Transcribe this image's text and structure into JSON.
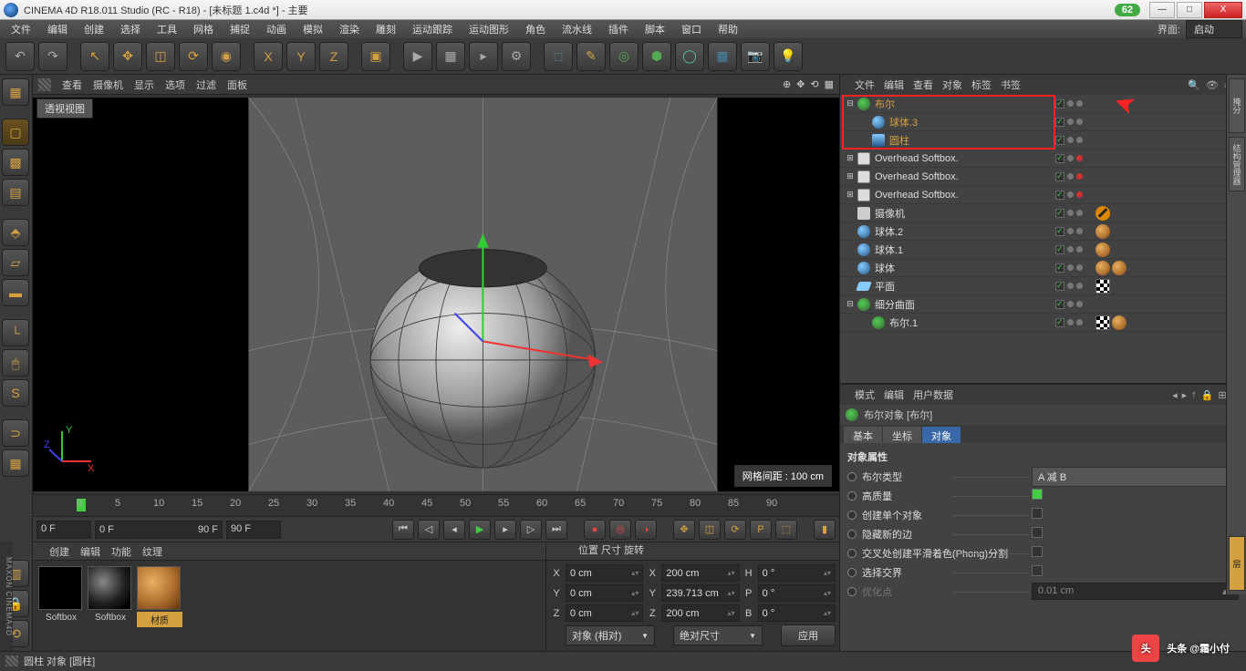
{
  "window": {
    "title": "CINEMA 4D R18.011 Studio (RC - R18) - [未标题 1.c4d *] - 主要",
    "badge": "62"
  },
  "winbtns": {
    "min": "—",
    "max": "□",
    "close": "X"
  },
  "menu": [
    "文件",
    "编辑",
    "创建",
    "选择",
    "工具",
    "网格",
    "捕捉",
    "动画",
    "模拟",
    "渲染",
    "雕刻",
    "运动跟踪",
    "运动图形",
    "角色",
    "流水线",
    "插件",
    "脚本",
    "窗口",
    "帮助"
  ],
  "menuRight": {
    "label": "界面:",
    "value": "启动"
  },
  "viewportMenu": [
    "查看",
    "摄像机",
    "显示",
    "选项",
    "过滤",
    "面板"
  ],
  "viewport": {
    "label": "透视视图",
    "gridInfo": "网格间距 : 100 cm",
    "axes": {
      "x": "X",
      "y": "Y",
      "z": "Z"
    }
  },
  "timeline": {
    "ticks": [
      "0",
      "5",
      "10",
      "15",
      "20",
      "25",
      "30",
      "35",
      "40",
      "45",
      "50",
      "55",
      "60",
      "65",
      "70",
      "75",
      "80",
      "85",
      "90"
    ]
  },
  "playbar": {
    "cur": "0 F",
    "rangeStart": "0 F",
    "rangeEnd": "90 F",
    "end": "90 F"
  },
  "materials": {
    "menu": [
      "创建",
      "编辑",
      "功能",
      "纹理"
    ],
    "items": [
      {
        "type": "black",
        "label": "Softbox"
      },
      {
        "type": "ball",
        "label": "Softbox"
      },
      {
        "type": "wood",
        "label": "材质",
        "sel": true
      }
    ]
  },
  "coords": {
    "heads": [
      "位置",
      "尺寸",
      "旋转"
    ],
    "rows": [
      {
        "axis": "X",
        "pos": "0 cm",
        "size": "200 cm",
        "rlabel": "H",
        "rot": "0 °"
      },
      {
        "axis": "Y",
        "pos": "0 cm",
        "size": "239.713 cm",
        "rlabel": "P",
        "rot": "0 °"
      },
      {
        "axis": "Z",
        "pos": "0 cm",
        "size": "200 cm",
        "rlabel": "B",
        "rot": "0 °"
      }
    ],
    "sel1": "对象 (相对)",
    "sel2": "绝对尺寸",
    "apply": "应用"
  },
  "objMenu": [
    "文件",
    "编辑",
    "查看",
    "对象",
    "标签",
    "书签"
  ],
  "objects": [
    {
      "depth": 0,
      "exp": "⊟",
      "icon": "bool",
      "label": "布尔",
      "sel": true,
      "chk": true,
      "dots": [
        "gy",
        "gy"
      ]
    },
    {
      "depth": 1,
      "exp": "",
      "icon": "sphere",
      "label": "球体.3",
      "sel": true,
      "chk": true,
      "dots": [
        "gy",
        "gy"
      ],
      "tags": [
        "dots"
      ]
    },
    {
      "depth": 1,
      "exp": "",
      "icon": "cyl",
      "label": "圆柱",
      "sel": true,
      "chk": true,
      "dots": [
        "gy",
        "gy"
      ],
      "tags": [
        "dots"
      ]
    },
    {
      "depth": 0,
      "exp": "⊞",
      "icon": "light",
      "label": "Overhead Softbox.",
      "chk": true,
      "dots": [
        "gy",
        "rd"
      ],
      "tags": [
        "dots"
      ]
    },
    {
      "depth": 0,
      "exp": "⊞",
      "icon": "light",
      "label": "Overhead Softbox.",
      "chk": true,
      "dots": [
        "gy",
        "rd"
      ],
      "tags": [
        "dots"
      ]
    },
    {
      "depth": 0,
      "exp": "⊞",
      "icon": "light",
      "label": "Overhead Softbox.",
      "chk": true,
      "dots": [
        "gy",
        "rd"
      ],
      "tags": [
        "dots"
      ]
    },
    {
      "depth": 0,
      "exp": "",
      "icon": "cam",
      "label": "摄像机",
      "chk": true,
      "dots": [
        "gy",
        "gy"
      ],
      "tags": [
        "no"
      ]
    },
    {
      "depth": 0,
      "exp": "",
      "icon": "sphere",
      "label": "球体.2",
      "chk": true,
      "dots": [
        "gy",
        "gy"
      ],
      "tags": [
        "dots",
        "mat"
      ]
    },
    {
      "depth": 0,
      "exp": "",
      "icon": "sphere",
      "label": "球体.1",
      "chk": true,
      "dots": [
        "gy",
        "gy"
      ],
      "tags": [
        "dots",
        "mat"
      ]
    },
    {
      "depth": 0,
      "exp": "",
      "icon": "sphere",
      "label": "球体",
      "chk": true,
      "dots": [
        "gy",
        "gy"
      ],
      "tags": [
        "dots",
        "mat",
        "mat"
      ]
    },
    {
      "depth": 0,
      "exp": "",
      "icon": "plane",
      "label": "平面",
      "chk": true,
      "dots": [
        "gy",
        "gy"
      ],
      "tags": [
        "dots",
        "chk"
      ]
    },
    {
      "depth": 0,
      "exp": "⊟",
      "icon": "subdiv",
      "label": "细分曲面",
      "chk": true,
      "dots": [
        "gy",
        "gy"
      ]
    },
    {
      "depth": 1,
      "exp": "",
      "icon": "bool",
      "label": "布尔.1",
      "chk": true,
      "dots": [
        "gy",
        "gy"
      ],
      "tags": [
        "chk",
        "mat"
      ]
    }
  ],
  "attrMenu": [
    "模式",
    "编辑",
    "用户数据"
  ],
  "attrTitle": "布尔对象 [布尔]",
  "attrTabs": [
    {
      "l": "基本"
    },
    {
      "l": "坐标"
    },
    {
      "l": "对象",
      "a": true
    }
  ],
  "attrSection": "对象属性",
  "attrs": [
    {
      "label": "布尔类型",
      "type": "sel",
      "value": "A 减 B"
    },
    {
      "label": "高质量",
      "type": "chk",
      "on": true
    },
    {
      "label": "创建单个对象",
      "type": "chk"
    },
    {
      "label": "隐藏新的边",
      "type": "chk"
    },
    {
      "label": "交叉处创建平滑着色(Phong)分割",
      "type": "chk"
    },
    {
      "label": "选择交界",
      "type": "chk"
    },
    {
      "label": "优化点",
      "type": "input",
      "value": "0.01 cm",
      "dim": true
    }
  ],
  "status": "圆柱 对象 [圆柱]",
  "watermark": "头条 @霜小付",
  "maxon": "MAXON CINEMA4D"
}
